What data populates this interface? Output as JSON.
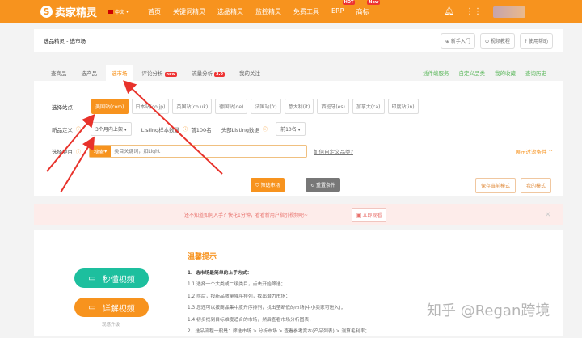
{
  "header": {
    "logo": "卖家精灵",
    "lang": "中文",
    "nav": [
      "首页",
      "关键词精灵",
      "选品精灵",
      "监控精灵",
      "免费工具",
      "ERP",
      "商标"
    ],
    "badges": {
      "ERP": "HOT",
      "商标": "New"
    }
  },
  "breadcrumb": "选品精灵 - 选市场",
  "help": [
    "新手入门",
    "视频教程",
    "使用帮助"
  ],
  "tabs": [
    "查商品",
    "选产品",
    "选市场",
    "评论分析",
    "流量分析",
    "我的关注"
  ],
  "tab_badges": {
    "评论分析": "new",
    "流量分析": "2.0"
  },
  "tab_links": [
    "插件端服务",
    "自定义品类",
    "我的收藏",
    "查询历史"
  ],
  "filters": {
    "site_label": "选择站点",
    "sites": [
      "美国站(com)",
      "日本站(co.jp)",
      "英国站(co.uk)",
      "德国站(de)",
      "法国站(fr)",
      "意大利(it)",
      "西班牙(es)",
      "加拿大(ca)",
      "印度站(in)"
    ],
    "new_label": "新品定义",
    "new_value": "3个月内上架",
    "listing_label": "Listing样本数量",
    "listing_value": "前100名",
    "head_label": "头部Listing数据",
    "head_value": "前10名",
    "cat_label": "选择类目",
    "search_type": "搜索",
    "search_placeholder": "类目关键词，如Light",
    "custom_link": "如何自定义品类?",
    "expand": "展示过滤条件"
  },
  "actions": {
    "filter": "筛选市场",
    "reset": "重置条件",
    "save": "保存当前模式",
    "mine": "我的模式"
  },
  "banner": {
    "text": "还不知道如何入手？快花1分钟，看看新用户指引视频吧~",
    "button": "立即观看"
  },
  "videos": [
    "秒懂视频",
    "详解视频"
  ],
  "video_note": "观感升级",
  "tips": {
    "title": "温馨提示",
    "lines": [
      "1、选市场最简单的上手方式：",
      "1.1 选择一个大类或二级类目，点击开始筛选；",
      "1.2 然后，按新品数量降序排列，找出潜力市场；",
      "1.3 您还可以按商品集中度升序排列，找出垄断低的市场(中小卖家可进入)；",
      "1.4 初步找到目标维度适合的市场，然后查看市场分析图表；",
      "2、选品流程一般是：筛选市场 > 分析市场 > 查看参考竞本(产品列表) > 测算毛利率；"
    ]
  },
  "watermark": "知乎 @Regan跨境"
}
